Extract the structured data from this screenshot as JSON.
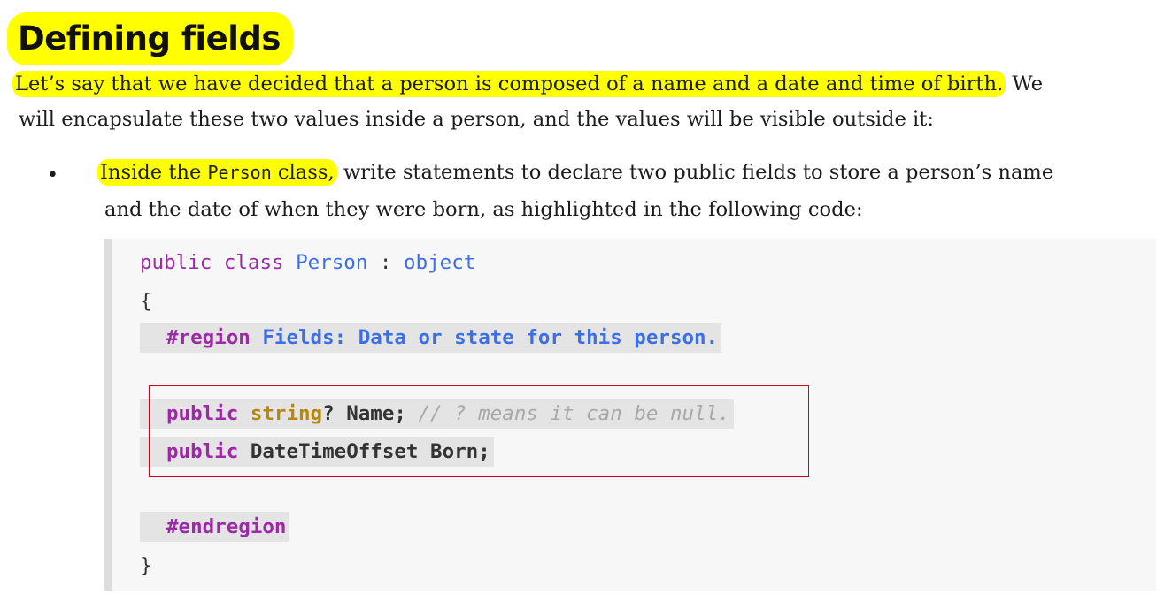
{
  "heading": "Defining fields",
  "intro": {
    "highlighted": "Let’s say that we have decided that a person is composed of a name and a date and time of birth.",
    "rest_line1": " We",
    "line2": "will encapsulate these two values inside a person, and the values will be visible outside it:"
  },
  "bullet": {
    "marker": "•",
    "hl_pre": "Inside the ",
    "hl_code": "Person",
    "hl_post": " class,",
    "rest_line1": " write statements to declare two public fields to store a person’s name",
    "line2": "and the date of when they were born, as highlighted in the following code:"
  },
  "code": {
    "l1_public": "public",
    "l1_class": "class",
    "l1_name": "Person",
    "l1_colon": " : ",
    "l1_object": "object",
    "l2": "{",
    "l3_region": "#region",
    "l3_text": " Fields: Data or state for this person.",
    "l4_public": "public",
    "l4_string": "string",
    "l4_rest": "? Name; ",
    "l4_comment": "// ? means it can be null.",
    "l5_public": "public",
    "l5_rest": " DateTimeOffset Born;",
    "l6_endregion": "#endregion",
    "l7": "}"
  },
  "colors": {
    "highlight": "#ffff00",
    "keyword_purple": "#9c2aa6",
    "keyword_blue": "#3c6ee6",
    "type_gold": "#b8860b",
    "comment_gray": "#a8a8a8",
    "annotation_red": "#d0021b"
  }
}
